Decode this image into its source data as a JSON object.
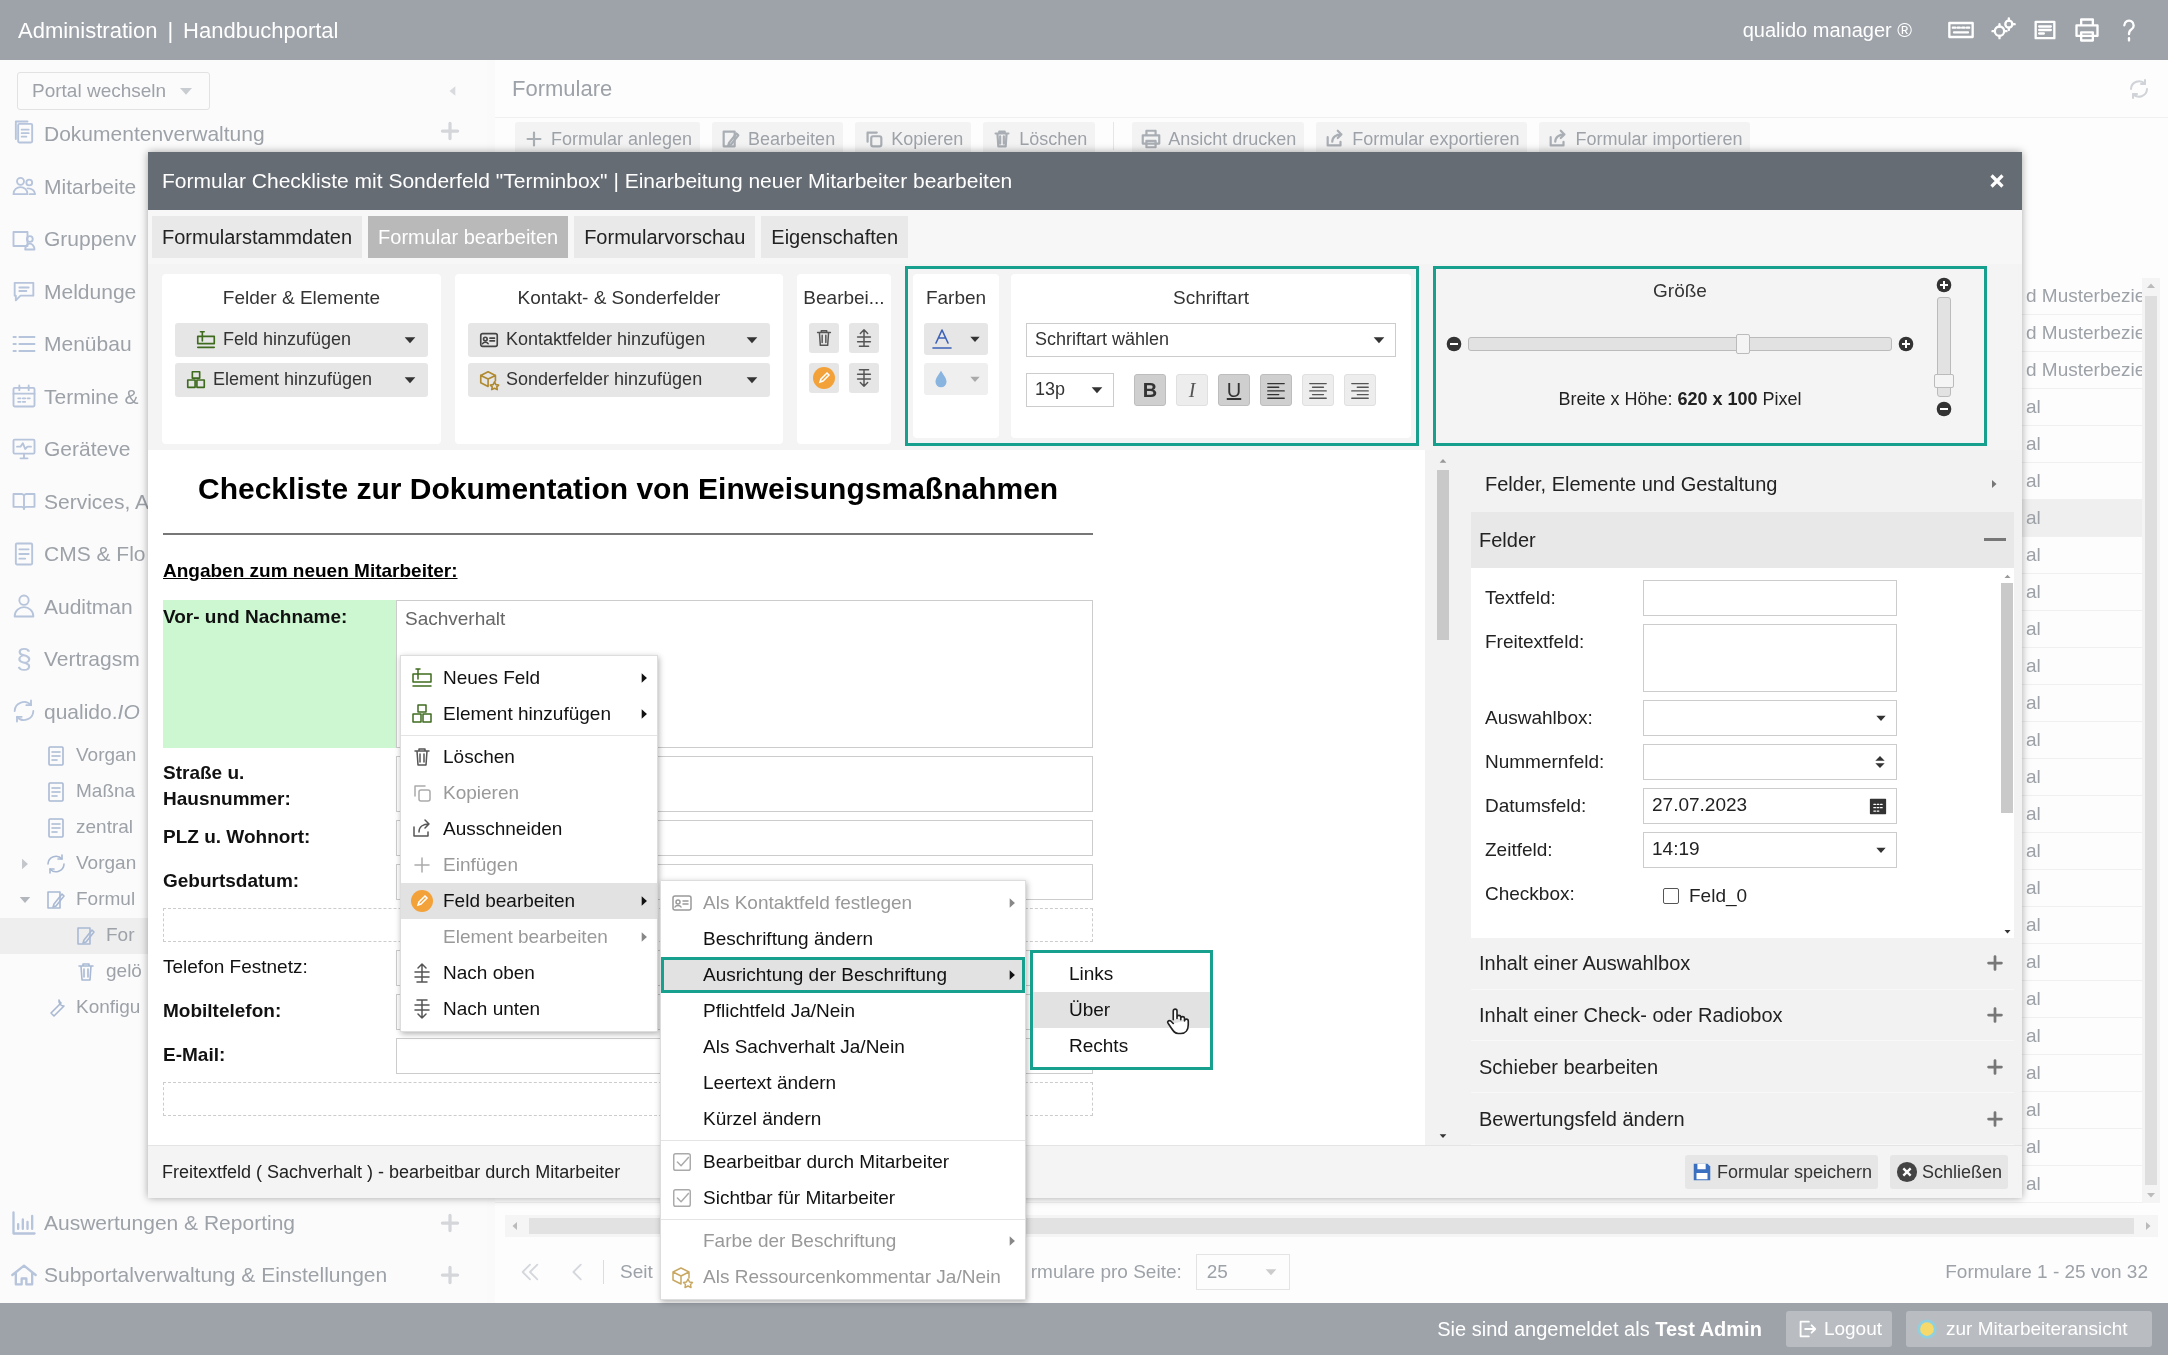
{
  "header": {
    "title": "Administration",
    "separator": "|",
    "portal": "Handbuchportal",
    "product": "qualido manager ®"
  },
  "sidebar": {
    "portal_select": {
      "placeholder": "Portal wechseln"
    },
    "items": [
      {
        "label": "Dokumentenverwaltung"
      },
      {
        "label": "Mitarbeite"
      },
      {
        "label": "Gruppenv"
      },
      {
        "label": "Meldunge"
      },
      {
        "label": "Menübau"
      },
      {
        "label": "Termine &"
      },
      {
        "label": "Geräteve"
      },
      {
        "label": "Services, A"
      },
      {
        "label": "CMS & Flo"
      },
      {
        "label": "Auditman"
      },
      {
        "label": "Vertragsm",
        "glyph": "§"
      },
      {
        "label": "qualido.*IO*",
        "children": [
          {
            "label": "Vorgan",
            "selected": false
          },
          {
            "label": "Maßna",
            "selected": false
          },
          {
            "label": "zentral",
            "selected": false
          },
          {
            "label": "Vorgan",
            "selected": false,
            "expanded": false
          },
          {
            "label": "Formul",
            "selected": false,
            "expanded": true,
            "children": [
              {
                "label": "For",
                "selected": true
              },
              {
                "label": "gelö",
                "selected": false
              }
            ]
          },
          {
            "label": "Konfigu",
            "selected": false
          }
        ]
      }
    ],
    "bottom_items": [
      {
        "label": "Auswertungen & Reporting"
      },
      {
        "label": "Subportalverwaltung & Einstellungen"
      }
    ]
  },
  "main": {
    "title": "Formulare",
    "toolbar": [
      "Formular anlegen",
      "Bearbeiten",
      "Kopieren",
      "Löschen",
      "Ansicht drucken",
      "Formular exportieren",
      "Formular importieren"
    ],
    "rows": [
      {
        "column_1": "d Musterbezie",
        "selected": false
      },
      {
        "column_1": "d Musterbezie",
        "selected": false
      },
      {
        "column_1": "d Musterbezie",
        "selected": false
      },
      {
        "column_1": "al",
        "selected": false
      },
      {
        "column_1": "al",
        "selected": false
      },
      {
        "column_1": "al",
        "selected": false
      },
      {
        "column_1": "al",
        "selected": true
      },
      {
        "column_1": "al",
        "selected": false
      },
      {
        "column_1": "al",
        "selected": false
      },
      {
        "column_1": "al",
        "selected": false
      },
      {
        "column_1": "al",
        "selected": false
      },
      {
        "column_1": "al",
        "selected": false
      },
      {
        "column_1": "al",
        "selected": false
      },
      {
        "column_1": "al",
        "selected": false
      },
      {
        "column_1": "al",
        "selected": false
      },
      {
        "column_1": "al",
        "selected": false
      },
      {
        "column_1": "al",
        "selected": false
      },
      {
        "column_1": "al",
        "selected": false
      },
      {
        "column_1": "al",
        "selected": false
      },
      {
        "column_1": "al",
        "selected": false
      },
      {
        "column_1": "al",
        "selected": false
      },
      {
        "column_1": "al",
        "selected": false
      },
      {
        "column_1": "al",
        "selected": false
      },
      {
        "column_1": "al",
        "selected": false
      },
      {
        "column_1": "al",
        "selected": false
      }
    ],
    "pagination": {
      "page_label": "Seit",
      "per_page_label": "rmulare pro Seite:",
      "per_page": "25",
      "summary": "Formulare 1 - 25 von 32"
    }
  },
  "status_bar": {
    "login": "Sie sind angemeldet als **Test Admin**",
    "logout": "Logout",
    "switch": "zur Mitarbeiteransicht"
  },
  "dialog": {
    "title": "Formular Checkliste mit Sonderfeld \"Terminbox\" | Einarbeitung neuer Mitarbeiter bearbeiten",
    "tabs": [
      {
        "label": "Formularstammdaten",
        "selected": false
      },
      {
        "label": "Formular bearbeiten",
        "selected": true
      },
      {
        "label": "Formularvorschau",
        "selected": false
      },
      {
        "label": "Eigenschaften",
        "selected": false
      }
    ],
    "groups": [
      {
        "title": "Felder & Elemente",
        "buttons": [
          "Feld hinzufügen",
          "Element hinzufügen"
        ]
      },
      {
        "title": "Kontakt- & Sonderfelder",
        "buttons": [
          "Kontaktfelder hinzufügen",
          "Sonderfelder hinzufügen"
        ]
      }
    ],
    "edit_group": {
      "title": "Bearbei..."
    },
    "colors": {
      "title": "Farben"
    },
    "font": {
      "title": "Schriftart",
      "select": "Schriftart wählen",
      "size": "13p",
      "format": [
        {
          "kind": "text",
          "label": "B",
          "on": true
        },
        {
          "kind": "text",
          "label": "I",
          "on": false
        },
        {
          "kind": "text",
          "label": "U",
          "on": true
        },
        {
          "kind": "align",
          "on": true
        },
        {
          "kind": "align",
          "on": false
        },
        {
          "kind": "align",
          "on": false
        }
      ]
    },
    "size": {
      "title": "Größe",
      "width_slider": {
        "level": 0.65
      },
      "height_slider": {
        "level": 0.15
      },
      "text": "Breite x Höhe: **620 x 100** Pixel"
    },
    "form": {
      "heading": "Checkliste zur Dokumentation von Einweisungsmaßnahmen",
      "section": "Angaben zum neuen Mitarbeiter:",
      "rows": [
        {
          "kind": "field",
          "label": "Vor- und Nachname:",
          "bold": true,
          "selected": true,
          "placeholder": "Sachverhalt"
        },
        {
          "kind": "field",
          "label": "Straße u. Hausnummer:",
          "bold": true,
          "selected": false
        },
        {
          "kind": "field",
          "label": "PLZ u. Wohnort:",
          "bold": true,
          "selected": false
        },
        {
          "kind": "field",
          "label": "Geburtsdatum:",
          "bold": true,
          "selected": false
        },
        {
          "kind": "spacer"
        },
        {
          "kind": "field",
          "label": "Telefon Festnetz:",
          "bold": false,
          "selected": false
        },
        {
          "kind": "field",
          "label": "Mobiltelefon:",
          "bold": true,
          "selected": false
        },
        {
          "kind": "field",
          "label": "E-Mail:",
          "bold": true,
          "selected": false
        },
        {
          "kind": "spacer"
        }
      ]
    },
    "panel": {
      "top_section": "Felder, Elemente und Gestaltung",
      "open_section": "Felder",
      "preview": [
        {
          "kind": "text",
          "label": "Textfeld:"
        },
        {
          "kind": "textarea",
          "label": "Freitextfeld:"
        },
        {
          "kind": "select",
          "label": "Auswahlbox:"
        },
        {
          "kind": "number",
          "label": "Nummernfeld:"
        },
        {
          "kind": "date",
          "label": "Datumsfeld:",
          "value": "27.07.2023"
        },
        {
          "kind": "select",
          "label": "Zeitfeld:",
          "value": "14:19"
        },
        {
          "kind": "checkbox",
          "label": "Checkbox:",
          "option": "Feld_0",
          "checked": false
        }
      ],
      "sections": [
        "Inhalt einer Auswahlbox",
        "Inhalt einer Check- oder Radiobox",
        "Schieber bearbeiten",
        "Bewertungsfeld ändern"
      ]
    },
    "status": "Freitextfeld ( Sachverhalt ) - bearbeitbar durch Mitarbeiter",
    "buttons": [
      "Formular speichern",
      "Schließen"
    ]
  },
  "context_menu": [
    {
      "kind": "item",
      "label": "Neues Feld",
      "disabled": false,
      "submenu": true,
      "active": false
    },
    {
      "kind": "item",
      "label": "Element hinzufügen",
      "disabled": false,
      "submenu": true,
      "active": false
    },
    {
      "kind": "separator"
    },
    {
      "kind": "item",
      "label": "Löschen",
      "disabled": false,
      "submenu": false,
      "active": false
    },
    {
      "kind": "item",
      "label": "Kopieren",
      "disabled": true,
      "submenu": false,
      "active": false
    },
    {
      "kind": "item",
      "label": "Ausschneiden",
      "disabled": false,
      "submenu": false,
      "active": false
    },
    {
      "kind": "item",
      "label": "Einfügen",
      "disabled": true,
      "submenu": false,
      "active": false
    },
    {
      "kind": "item",
      "label": "Feld bearbeiten",
      "disabled": false,
      "submenu": true,
      "active": true
    },
    {
      "kind": "item",
      "label": "Element bearbeiten",
      "disabled": true,
      "submenu": true,
      "active": false
    },
    {
      "kind": "item",
      "label": "Nach oben",
      "disabled": false,
      "submenu": false,
      "active": false
    },
    {
      "kind": "item",
      "label": "Nach unten",
      "disabled": false,
      "submenu": false,
      "active": false
    }
  ],
  "submenu": [
    {
      "kind": "item",
      "label": "Als Kontaktfeld festlegen",
      "disabled": true,
      "submenu": true,
      "active": false
    },
    {
      "kind": "item",
      "label": "Beschriftung ändern",
      "disabled": false,
      "submenu": false,
      "active": false
    },
    {
      "kind": "item",
      "label": "Ausrichtung der Beschriftung",
      "disabled": false,
      "submenu": true,
      "active": true
    },
    {
      "kind": "item",
      "label": "Pflichtfeld Ja/Nein",
      "disabled": false,
      "submenu": false,
      "active": false
    },
    {
      "kind": "item",
      "label": "Als Sachverhalt Ja/Nein",
      "disabled": false,
      "submenu": false,
      "active": false
    },
    {
      "kind": "item",
      "label": "Leertext ändern",
      "disabled": false,
      "submenu": false,
      "active": false
    },
    {
      "kind": "item",
      "label": "Kürzel ändern",
      "disabled": false,
      "submenu": false,
      "active": false
    },
    {
      "kind": "separator"
    },
    {
      "kind": "check",
      "label": "Bearbeitbar durch Mitarbeiter",
      "checked": true
    },
    {
      "kind": "check",
      "label": "Sichtbar für Mitarbeiter",
      "checked": true
    },
    {
      "kind": "separator"
    },
    {
      "kind": "item",
      "label": "Farbe der Beschriftung",
      "disabled": true,
      "submenu": true,
      "active": false
    },
    {
      "kind": "item",
      "label": "Als Ressourcenkommentar Ja/Nein",
      "disabled": true,
      "submenu": false,
      "active": false
    }
  ],
  "alignment_menu": [
    {
      "label": "Links",
      "selected": false
    },
    {
      "label": "Über",
      "selected": true
    },
    {
      "label": "Rechts",
      "selected": false
    }
  ]
}
